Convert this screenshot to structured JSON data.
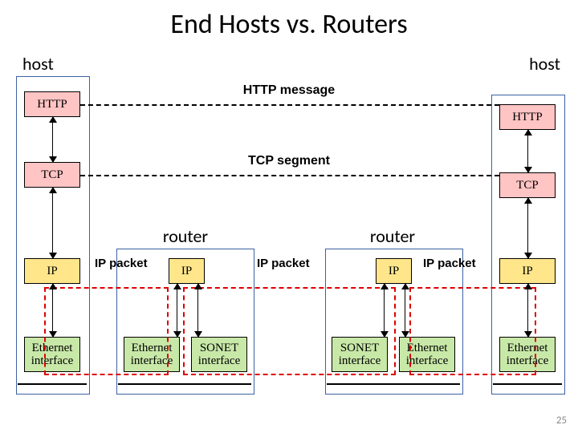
{
  "title": "End Hosts vs. Routers",
  "labels": {
    "host_left": "host",
    "host_right": "host",
    "router_left": "router",
    "router_right": "router"
  },
  "messages": {
    "http": "HTTP message",
    "tcp": "TCP segment",
    "ip1": "IP packet",
    "ip2": "IP packet",
    "ip3": "IP packet"
  },
  "stack": {
    "left": {
      "http": "HTTP",
      "tcp": "TCP",
      "ip": "IP",
      "eth": "Ethernet\ninterface"
    },
    "right": {
      "http": "HTTP",
      "tcp": "TCP",
      "ip": "IP",
      "eth": "Ethernet\ninterface"
    },
    "router1": {
      "ip": "IP",
      "left_if": "Ethernet\ninterface",
      "right_if": "SONET\ninterface"
    },
    "router2": {
      "ip": "IP",
      "left_if": "SONET\ninterface",
      "right_if": "Ethernet\ninterface"
    }
  },
  "slide_number": "25"
}
